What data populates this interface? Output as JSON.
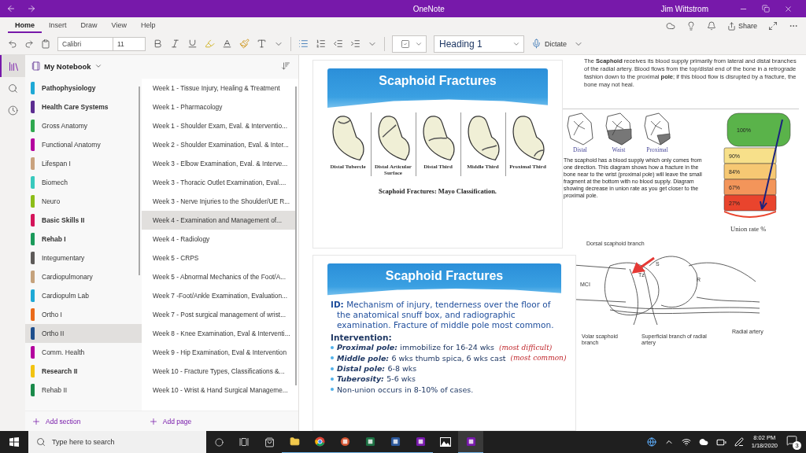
{
  "window": {
    "title": "OneNote",
    "user": "Jim Wittstrom"
  },
  "ribbon_tabs": [
    {
      "label": "Home",
      "selected": true
    },
    {
      "label": "Insert",
      "selected": false
    },
    {
      "label": "Draw",
      "selected": false
    },
    {
      "label": "View",
      "selected": false
    },
    {
      "label": "Help",
      "selected": false
    }
  ],
  "share_label": "Share",
  "toolbar": {
    "font": "Calibri",
    "size": "11",
    "style": "Heading 1",
    "dictate": "Dictate"
  },
  "notebook": {
    "name": "My Notebook"
  },
  "sections": [
    {
      "name": "Pathophysiology",
      "color": "#1fa9d6",
      "unread": true,
      "selected": false
    },
    {
      "name": "Health Care Systems",
      "color": "#5c2d91",
      "unread": true,
      "selected": false
    },
    {
      "name": "Gross Anatomy",
      "color": "#2fa84f",
      "unread": false,
      "selected": false
    },
    {
      "name": "Functional Anatomy",
      "color": "#b4009e",
      "unread": false,
      "selected": false
    },
    {
      "name": "Lifespan I",
      "color": "#c9a27e",
      "unread": false,
      "selected": false
    },
    {
      "name": "Biomech",
      "color": "#38c9bd",
      "unread": false,
      "selected": false
    },
    {
      "name": "Neuro",
      "color": "#8cbd18",
      "unread": false,
      "selected": false
    },
    {
      "name": "Basic Skills II",
      "color": "#d4145a",
      "unread": true,
      "selected": false
    },
    {
      "name": "Rehab I",
      "color": "#1a9a5a",
      "unread": true,
      "selected": false
    },
    {
      "name": "Integumentary",
      "color": "#5d5a58",
      "unread": false,
      "selected": false
    },
    {
      "name": "Cardiopulmonary",
      "color": "#c5a27c",
      "unread": false,
      "selected": false
    },
    {
      "name": "Cardiopulm Lab",
      "color": "#1fa9d6",
      "unread": false,
      "selected": false
    },
    {
      "name": "Ortho I",
      "color": "#ea6a1a",
      "unread": false,
      "selected": false
    },
    {
      "name": "Ortho II",
      "color": "#1e4e8c",
      "unread": false,
      "selected": true
    },
    {
      "name": "Comm. Health",
      "color": "#b4009e",
      "unread": false,
      "selected": false
    },
    {
      "name": "Research II",
      "color": "#f2c311",
      "unread": true,
      "selected": false
    },
    {
      "name": "Rehab II",
      "color": "#1a8a4a",
      "unread": false,
      "selected": false
    }
  ],
  "pages": [
    {
      "title": "Week 1 - Tissue Injury, Healing & Treatment",
      "selected": false
    },
    {
      "title": "Week 1 - Pharmacology",
      "selected": false
    },
    {
      "title": "Week 1 - Shoulder Exam, Eval. & Interventio...",
      "selected": false
    },
    {
      "title": "Week 2 - Shoulder Examination, Eval. & Inter...",
      "selected": false
    },
    {
      "title": "Week 3 - Elbow Examination, Eval. & Interve...",
      "selected": false
    },
    {
      "title": "Week 3 - Thoracic Outlet Examination, Eval....",
      "selected": false
    },
    {
      "title": "Week 3 - Nerve Injuries to the Shoulder/UE R...",
      "selected": false
    },
    {
      "title": "Week 4 - Examination and Management of...",
      "selected": true
    },
    {
      "title": "Week 4 - Radiology",
      "selected": false
    },
    {
      "title": "Week 5 - CRPS",
      "selected": false
    },
    {
      "title": "Week 5 - Abnormal Mechanics of the Foot/A...",
      "selected": false
    },
    {
      "title": "Week 7 -Foot/Ankle Examination, Evaluation...",
      "selected": false
    },
    {
      "title": "Week 7 - Post surgical management of wrist...",
      "selected": false
    },
    {
      "title": "Week 8 - Knee Examination, Eval & Interventi...",
      "selected": false
    },
    {
      "title": "Week 9 - Hip Examination, Eval & Intervention",
      "selected": false
    },
    {
      "title": "Week 10 - Fracture Types, Classifications &...",
      "selected": false
    },
    {
      "title": "Week 10 - Wrist & Hand Surgical Manageme...",
      "selected": false
    }
  ],
  "add_section": "Add section",
  "add_page": "Add page",
  "canvas": {
    "slide_1": {
      "title": "Scaphoid Fractures",
      "figures": [
        "Distal Tubercle",
        "Distal Articular Surface",
        "Distal Third",
        "Middle Third",
        "Proximal Third"
      ],
      "caption": "Scaphoid Fractures: Mayo Classification."
    },
    "note_text": "The **Scaphoid** receives its blood supply primarily from lateral and distal branches of the radial artery. Blood flows from the top/distal end of the bone in a retrograde fashion down to the proximal **pole**; if this blood flow is disrupted by a fracture, the bone may not heal.",
    "blood_supply": {
      "views": [
        "Distal",
        "Waist",
        "Proximal"
      ],
      "caption": "The scaphoid has a blood supply which only comes from one direction. This diagram shows how a fracture in the bone near to the wrist (proximal pole) will leave the small fragment at the bottom with no blood supply. Diagram showing decrease in union rate as you get closer to the proximal pole.",
      "union_bands": [
        "100%",
        "90%",
        "84%",
        "67%",
        "27%"
      ],
      "union_label": "Union rate %"
    },
    "anatomy_labels": [
      "Dorsal scaphoid branch",
      "S",
      "Tz",
      "MCI",
      "R",
      "Volar scaphoid branch",
      "Superficial branch of radial artery",
      "Radial artery"
    ],
    "slide_2": {
      "title": "Scaphoid Fractures",
      "id_text": "**ID:** Mechanism of injury, tenderness over the floor of the anatomical snuff box, and radiographic examination. Fracture of middle pole most common.",
      "intervention_heading": "Intervention:",
      "bullets": [
        {
          "term": "Proximal pole:",
          "text": "immobilize for 16-24 wks",
          "note": "(most difficult)"
        },
        {
          "term": "Middle pole:",
          "text": "6 wks thumb spica, 6 wks cast",
          "note": "(most common)"
        },
        {
          "term": "Distal pole:",
          "text": "6-8 wks"
        },
        {
          "term": "Tuberosity:",
          "text": "5-6 wks"
        },
        {
          "text": "Non-union occurs in 8-10% of cases."
        }
      ]
    }
  },
  "taskbar": {
    "search_placeholder": "Type here to search",
    "time": "8:02 PM",
    "date": "1/18/2020",
    "notification_count": "3"
  }
}
